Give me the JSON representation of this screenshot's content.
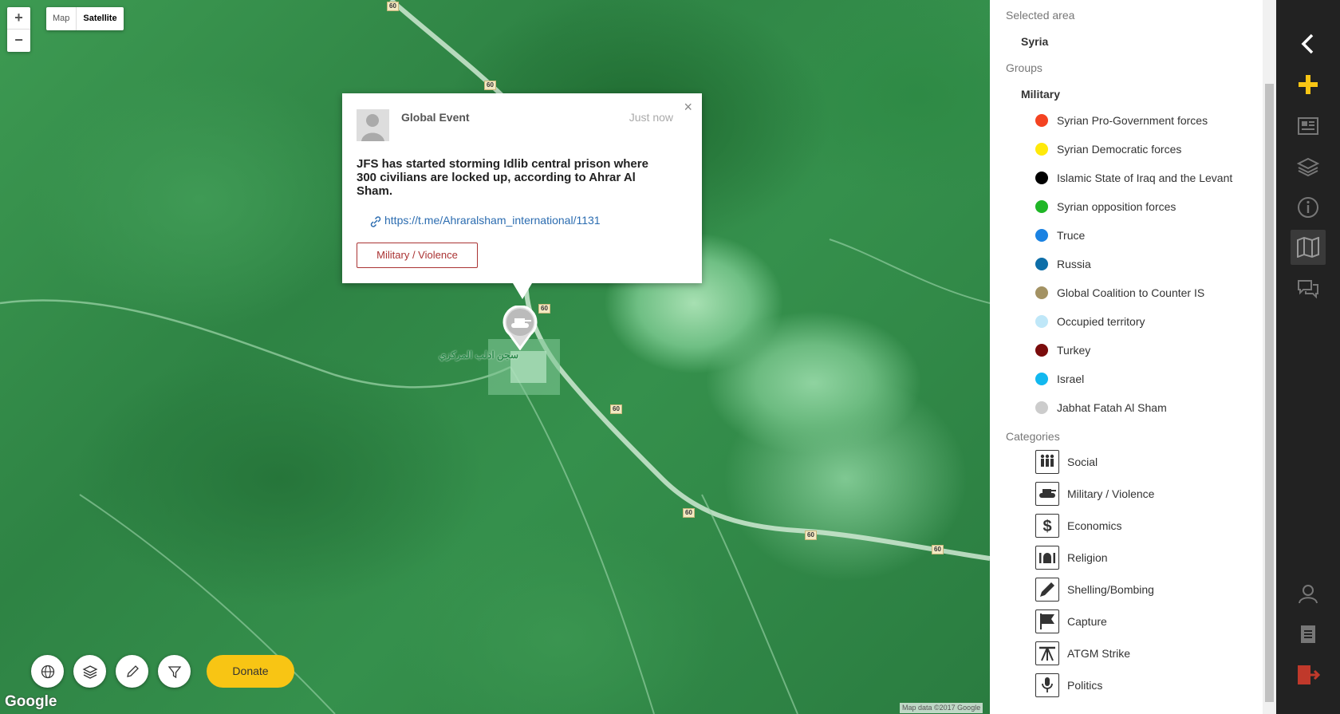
{
  "map": {
    "zoom_in": "+",
    "zoom_out": "−",
    "type_map": "Map",
    "type_satellite": "Satellite",
    "road_labels": [
      "60",
      "60",
      "60",
      "60",
      "60",
      "60",
      "60"
    ],
    "place_label": "سجن ادلب المركزي",
    "google_logo": "Google",
    "attribution": "Map data ©2017 Google",
    "donate_label": "Donate"
  },
  "popup": {
    "author": "Global Event",
    "time": "Just now",
    "close": "×",
    "body": "JFS has started storming Idlib central prison where 300 civilians are locked up, according to Ahrar Al Sham.",
    "link": "https://t.me/Ahraralsham_international/1131",
    "category": "Military / Violence"
  },
  "sidebar": {
    "selected_area_title": "Selected area",
    "selected_area": "Syria",
    "groups_title": "Groups",
    "groups_sub": "Military",
    "groups": [
      {
        "label": "Syrian Pro-Government forces",
        "color": "#f44321"
      },
      {
        "label": "Syrian Democratic forces",
        "color": "#ffe90a"
      },
      {
        "label": "Islamic State of Iraq and the Levant",
        "color": "#000000"
      },
      {
        "label": "Syrian opposition forces",
        "color": "#1fb626"
      },
      {
        "label": "Truce",
        "color": "#1a82e2"
      },
      {
        "label": "Russia",
        "color": "#0d6ea8"
      },
      {
        "label": "Global Coalition to Counter IS",
        "color": "#a39263"
      },
      {
        "label": "Occupied territory",
        "color": "#bfe7f8"
      },
      {
        "label": "Turkey",
        "color": "#7a0c0c"
      },
      {
        "label": "Israel",
        "color": "#12b8ef"
      },
      {
        "label": "Jabhat Fatah Al Sham",
        "color": "#cccccc"
      }
    ],
    "categories_title": "Categories",
    "categories": [
      {
        "label": "Social",
        "icon": "people-icon"
      },
      {
        "label": "Military / Violence",
        "icon": "tank-icon"
      },
      {
        "label": "Economics",
        "icon": "dollar-icon"
      },
      {
        "label": "Religion",
        "icon": "mosque-icon"
      },
      {
        "label": "Shelling/Bombing",
        "icon": "missile-icon"
      },
      {
        "label": "Capture",
        "icon": "flag-icon"
      },
      {
        "label": "ATGM Strike",
        "icon": "atgm-icon"
      },
      {
        "label": "Politics",
        "icon": "microphone-icon"
      }
    ]
  },
  "rail": {
    "accent": "#f8c514",
    "logout_color": "#c0392b"
  }
}
